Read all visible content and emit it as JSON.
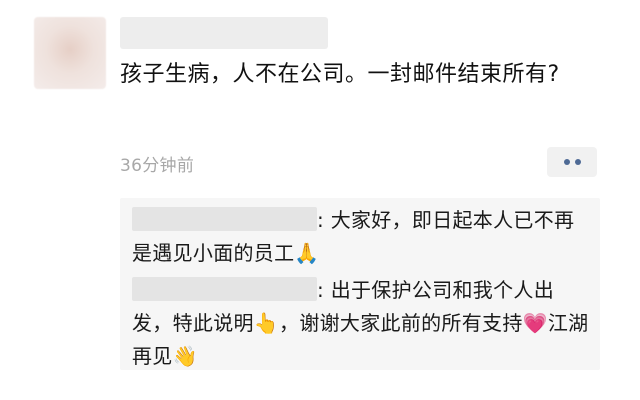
{
  "post": {
    "text": "孩子生病，人不在公司。一封邮件结束所有?",
    "time": "36分钟前"
  },
  "comments": [
    {
      "text_a": ": 大家好，即日起本人已不再是遇见小面的员工",
      "emoji_a": "🙏"
    },
    {
      "text_a": ": 出于保护公司和我个人出发，特此说明",
      "emoji_a": "👆",
      "text_b": "，谢谢大家此前的所有支持",
      "emoji_b": "💗",
      "text_c": "江湖再见",
      "emoji_c": "👋"
    }
  ],
  "icons": {
    "more": "more-dots-icon"
  },
  "colors": {
    "link_dots": "#4e6a95",
    "time_gray": "#a8a8a8",
    "comment_bg": "#f6f6f6"
  }
}
